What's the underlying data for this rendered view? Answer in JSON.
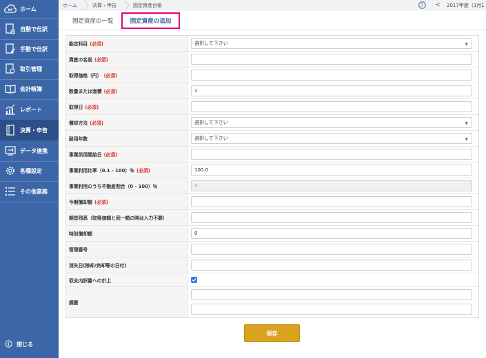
{
  "sidebar": {
    "logo_text": "MF",
    "items": [
      {
        "label": "ホーム",
        "icon": "cloud-icon"
      },
      {
        "label": "自動で仕訳",
        "icon": "auto-journal-icon"
      },
      {
        "label": "手動で仕訳",
        "icon": "manual-journal-icon"
      },
      {
        "label": "取引管理",
        "icon": "transaction-icon"
      },
      {
        "label": "会計帳簿",
        "icon": "ledger-book-icon"
      },
      {
        "label": "レポート",
        "icon": "chart-icon"
      },
      {
        "label": "決算・申告",
        "icon": "document-icon"
      },
      {
        "label": "データ連携",
        "icon": "data-link-icon"
      },
      {
        "label": "各種設定",
        "icon": "gear-icon"
      },
      {
        "label": "その他業務",
        "icon": "list-icon"
      }
    ],
    "close_label": "閉じる"
  },
  "breadcrumb": {
    "home": "ホーム",
    "level1": "決算・申告",
    "level2": "固定資産台帳"
  },
  "header": {
    "year": "2017年度（1月1"
  },
  "tabs": {
    "list": "固定資産の一覧",
    "add": "固定資産の追加"
  },
  "form": {
    "required_mark": "(必須)",
    "fields": [
      {
        "label": "勘定科目",
        "required": true,
        "type": "select",
        "value": "選択して下さい"
      },
      {
        "label": "資産の名前",
        "required": true,
        "type": "input",
        "value": ""
      },
      {
        "label": "取得価格（円）",
        "required": true,
        "type": "input",
        "value": ""
      },
      {
        "label": "数量または面積",
        "required": true,
        "type": "input",
        "value": "1"
      },
      {
        "label": "取得日",
        "required": true,
        "type": "input",
        "value": ""
      },
      {
        "label": "償却方法",
        "required": true,
        "type": "select",
        "value": "選択して下さい"
      },
      {
        "label": "耐用年数",
        "required": false,
        "type": "select",
        "value": "選択して下さい"
      },
      {
        "label": "事業供用開始日",
        "required": true,
        "type": "input",
        "value": ""
      },
      {
        "label": "事業利用比率（0.1 - 100）％",
        "required": true,
        "type": "input",
        "value": "100.0"
      },
      {
        "label": "事業利用のうち不動産割合（0 - 100）％",
        "required": false,
        "type": "disabled",
        "value": "0"
      },
      {
        "label": "今期償却額",
        "required": true,
        "type": "input",
        "value": ""
      },
      {
        "label": "期首残高（取得価額と同一額の時は入力不要）",
        "required": false,
        "type": "input",
        "value": ""
      },
      {
        "label": "特別償却額",
        "required": false,
        "type": "input",
        "value": "0"
      },
      {
        "label": "管理番号",
        "required": false,
        "type": "input",
        "value": ""
      },
      {
        "label": "消失日(除却/売却等の日付)",
        "required": false,
        "type": "input",
        "value": ""
      },
      {
        "label": "収支内訳書への計上",
        "required": false,
        "type": "checkbox",
        "value": "checked"
      },
      {
        "label": "摘要",
        "required": false,
        "type": "memo",
        "value": ""
      }
    ]
  },
  "save_label": "保存",
  "colors": {
    "sidebar": "#3c66a8",
    "sidebar_active": "#2b4f86",
    "required": "#d9342b",
    "tab_highlight": "#e5007f",
    "save_button": "#d9a21f",
    "checkbox": "#2f7de1"
  }
}
